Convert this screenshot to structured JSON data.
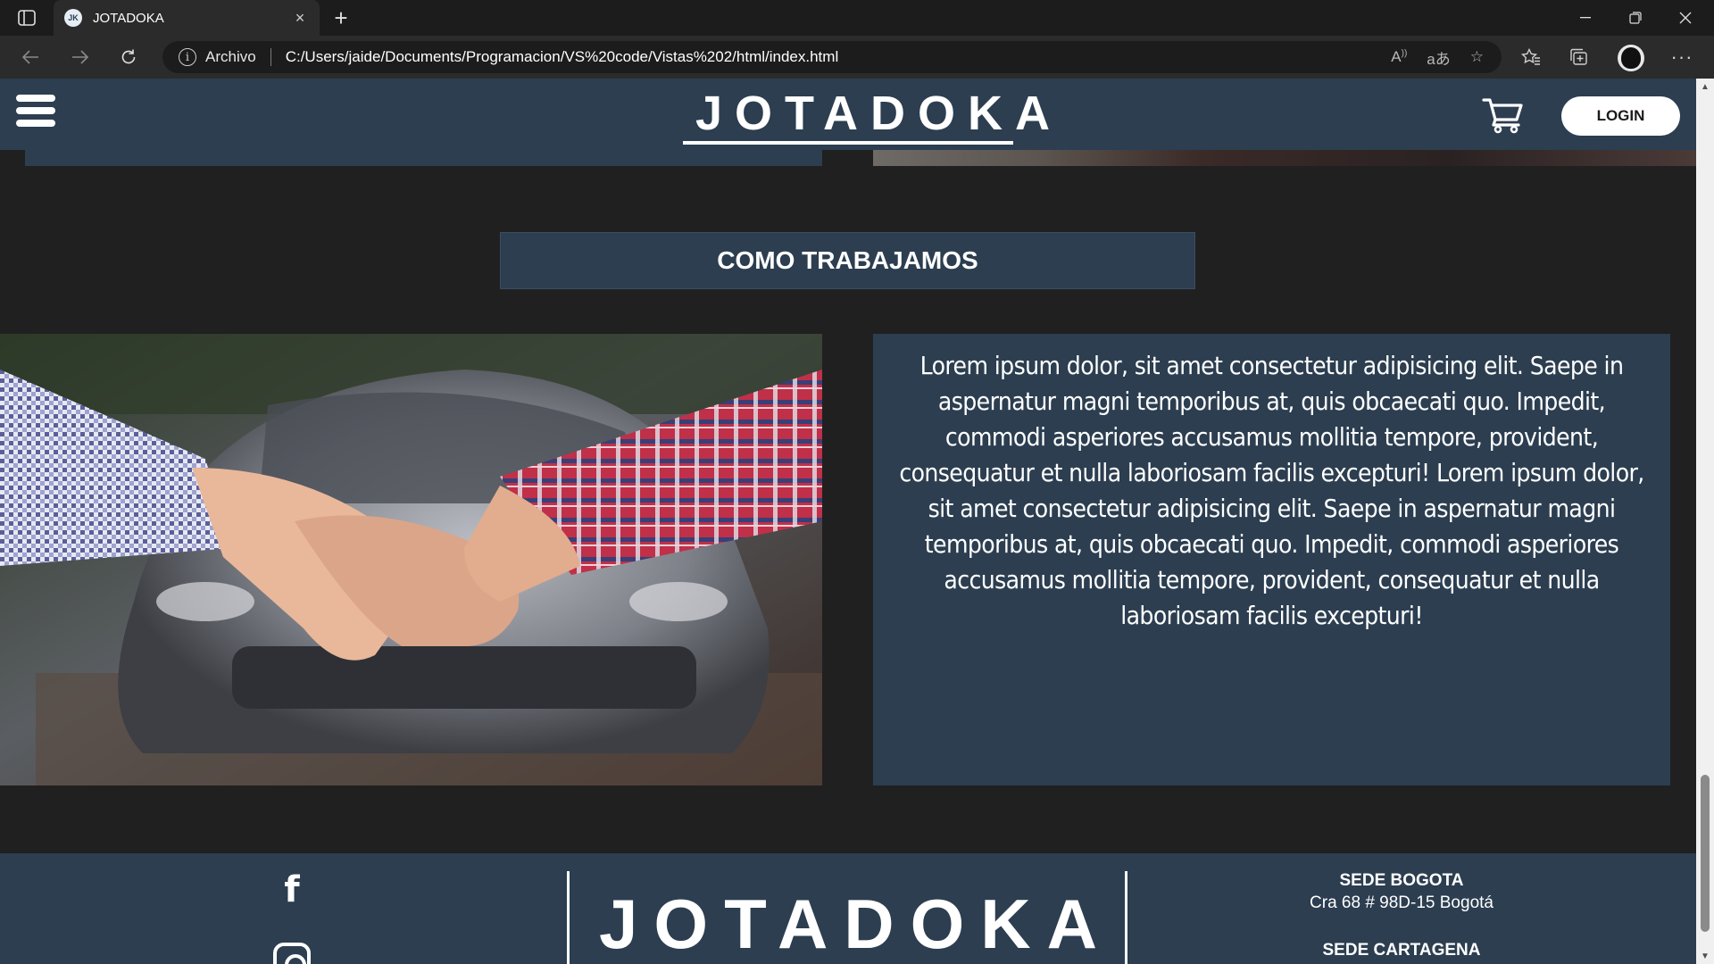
{
  "browser": {
    "tab": {
      "favicon": "JK",
      "title": "JOTADOKA"
    },
    "address": {
      "label": "Archivo",
      "url": "C:/Users/jaide/Documents/Programacion/VS%20code/Vistas%202/html/index.html"
    }
  },
  "header": {
    "brand": "JOTADOKA",
    "login_label": "LOGIN"
  },
  "section": {
    "title": "COMO TRABAJAMOS",
    "image_alt": "handshake-in-front-of-car",
    "body": "Lorem ipsum dolor, sit amet consectetur adipisicing elit. Saepe in aspernatur magni temporibus at, quis obcaecati quo. Impedit, commodi asperiores accusamus mollitia tempore, provident, consequatur et nulla laboriosam facilis excepturi! Lorem ipsum dolor, sit amet consectetur adipisicing elit. Saepe in aspernatur magni temporibus at, quis obcaecati quo. Impedit, commodi asperiores accusamus mollitia tempore, provident, consequatur et nulla laboriosam facilis excepturi!"
  },
  "footer": {
    "brand": "JOTADOKA",
    "social": [
      "facebook-icon",
      "instagram-icon"
    ],
    "sedes": [
      {
        "name": "SEDE BOGOTA",
        "address": "Cra 68 # 98D-15 Bogotá"
      },
      {
        "name": "SEDE CARTAGENA",
        "address": ""
      }
    ]
  },
  "colors": {
    "primary": "#2c3e50",
    "page_bg": "#202020",
    "text": "#ffffff"
  }
}
